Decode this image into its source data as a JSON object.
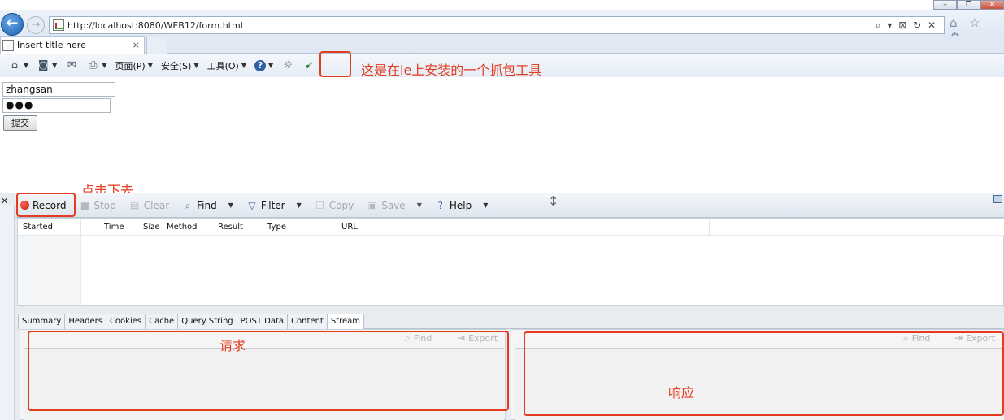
{
  "browser": {
    "url": "http://localhost:8080/WEB12/form.html",
    "tab_title": "Insert title here",
    "tab_close": "×",
    "window_caps": [
      "–",
      "❐",
      "✕"
    ],
    "addr_tools": "⌕ ▾ ⊠ ↻ ✕",
    "right_tools": "⌂ ☆ ⚙"
  },
  "command_bar": {
    "items": [
      {
        "icon": "home-icon",
        "label": "",
        "glyph": "⌂"
      },
      {
        "icon": "rss-icon",
        "label": "",
        "glyph": "◙"
      },
      {
        "icon": "mail-icon",
        "label": "",
        "glyph": "✉"
      },
      {
        "icon": "print-icon",
        "label": "",
        "glyph": "⎙"
      },
      {
        "icon": "",
        "label": "页面(P)",
        "glyph": ""
      },
      {
        "icon": "",
        "label": "安全(S)",
        "glyph": ""
      },
      {
        "icon": "",
        "label": "工具(O)",
        "glyph": ""
      },
      {
        "icon": "help-icon",
        "label": "",
        "glyph": "?"
      },
      {
        "icon": "settings-icon",
        "label": "",
        "glyph": "☼"
      },
      {
        "icon": "capture-tool-icon",
        "label": "",
        "glyph": "➹"
      }
    ]
  },
  "annotations": {
    "tool_note": "这是在ie上安装的一个抓包工具",
    "record_note": "点击下去",
    "request_note": "请求",
    "response_note": "响应"
  },
  "form": {
    "username": "zhangsan",
    "password": "●●●",
    "submit": "提交"
  },
  "devtool": {
    "close": "✕",
    "toolbar": [
      {
        "label": "Record",
        "disabled": false
      },
      {
        "label": "Stop",
        "disabled": true
      },
      {
        "label": "Clear",
        "disabled": true
      },
      {
        "label": "Find",
        "disabled": false
      },
      {
        "label": "Filter",
        "disabled": false
      },
      {
        "label": "Copy",
        "disabled": true
      },
      {
        "label": "Save",
        "disabled": true
      },
      {
        "label": "Help",
        "disabled": false
      }
    ],
    "columns": [
      "Started",
      "Time",
      "Size",
      "Method",
      "Result",
      "Type",
      "URL"
    ],
    "detail_tabs": [
      "Summary",
      "Headers",
      "Cookies",
      "Cache",
      "Query String",
      "POST Data",
      "Content",
      "Stream"
    ],
    "active_tab": "Stream",
    "pane_buttons": [
      "Find",
      "Export"
    ]
  }
}
